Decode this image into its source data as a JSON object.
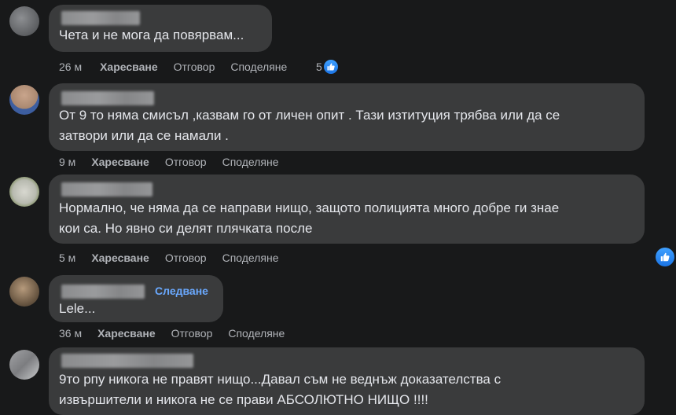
{
  "comments": [
    {
      "text": "Чета и не мога да повярвам...",
      "time": "26 м",
      "like": "Харесване",
      "reply": "Отговор",
      "share": "Споделяне",
      "reactions": "5"
    },
    {
      "text": "От 9 то няма смисъл ,казвам го от личен опит . Тази изтитуция трябва или да се\nзатвори или да се намали .",
      "time": "9 м",
      "like": "Харесване",
      "reply": "Отговор",
      "share": "Споделяне"
    },
    {
      "text": "Нормално, че няма да се направи нищо, защото полицията много добре ги знае\nкои са. Но явно си делят плячката после",
      "time": "5 м",
      "like": "Харесване",
      "reply": "Отговор",
      "share": "Споделяне"
    },
    {
      "follow": "Следване",
      "text": "Lele...",
      "time": "36 м",
      "like": "Харесване",
      "reply": "Отговор",
      "share": "Споделяне"
    },
    {
      "text": "9то рпу никога не правят нищо...Давал съм не веднъж доказателства с\nизвършители и никога не се прави АБСОЛЮТНО НИЩО !!!!"
    }
  ],
  "icons": {
    "reaction": "like-thumb-icon",
    "floating": "like-thumb-icon"
  },
  "colors": {
    "background": "#18191a",
    "bubble": "#3a3b3c",
    "link": "#6aa9ff",
    "like": "#1b74e4"
  }
}
